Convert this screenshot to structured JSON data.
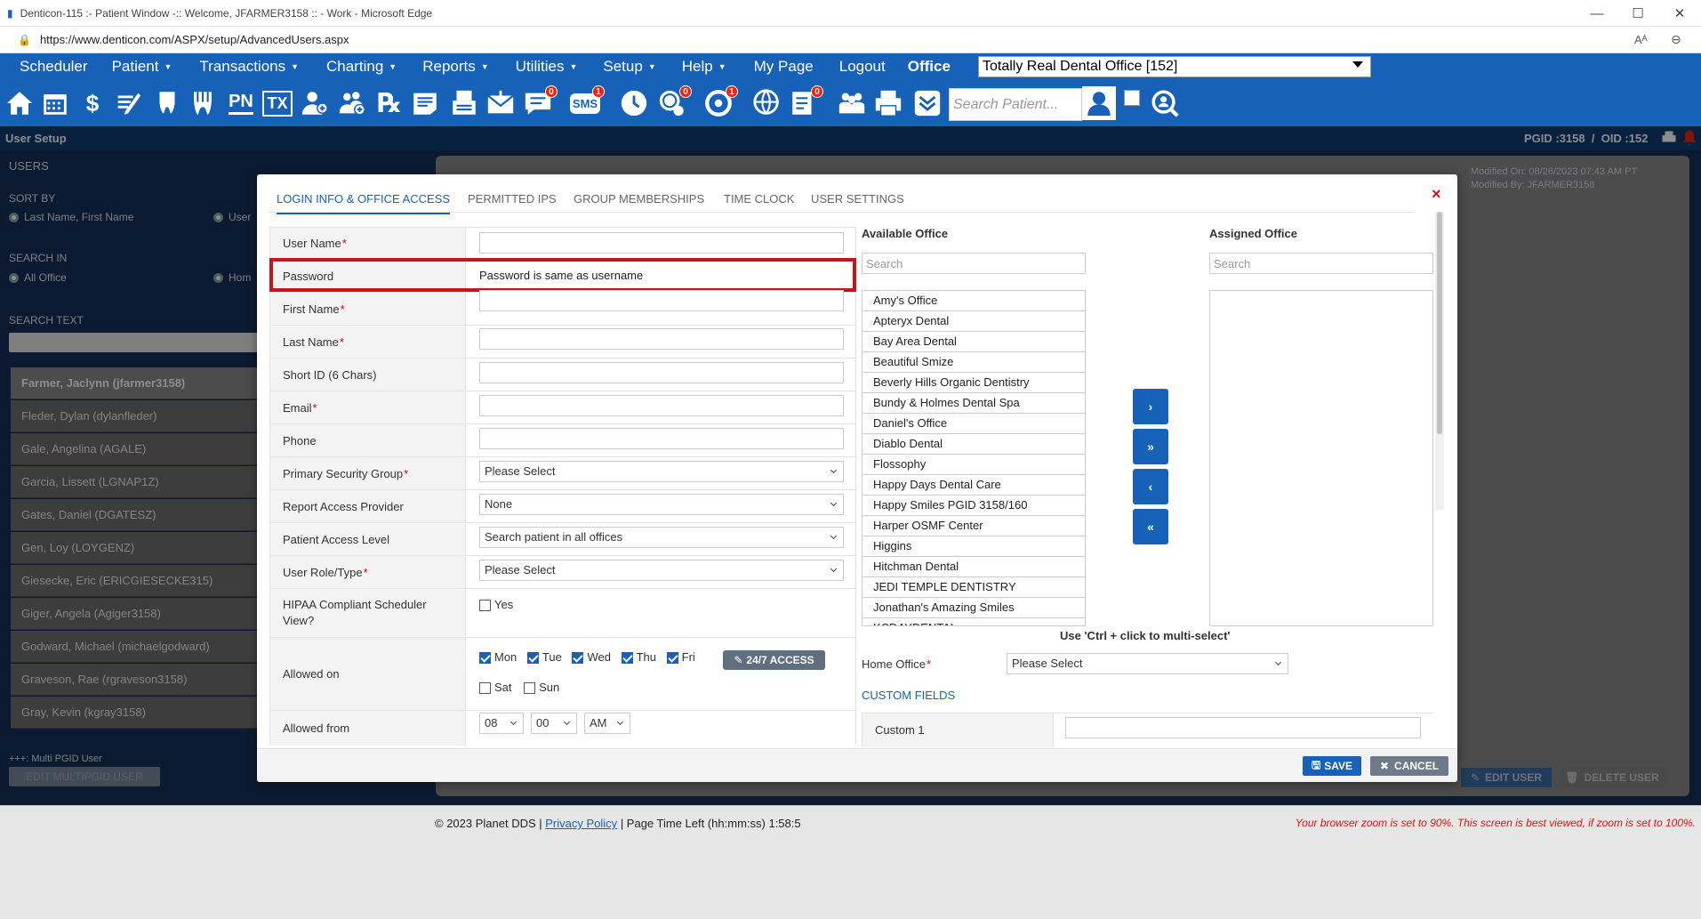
{
  "browser": {
    "title": "Denticon-115 :- Patient Window -:: Welcome, JFARMER3158 :: - Work - Microsoft Edge",
    "url": "https://www.denticon.com/ASPX/setup/AdvancedUsers.aspx"
  },
  "menu": {
    "items": [
      {
        "label": "Scheduler",
        "caret": ""
      },
      {
        "label": "Patient",
        "caret": "▼"
      },
      {
        "label": "Transactions",
        "caret": "▼"
      },
      {
        "label": "Charting",
        "caret": "▼"
      },
      {
        "label": "Reports",
        "caret": "▼"
      },
      {
        "label": "Utilities",
        "caret": "▼"
      },
      {
        "label": "Setup",
        "caret": "▼"
      },
      {
        "label": "Help",
        "caret": "▼"
      },
      {
        "label": "My Page",
        "caret": ""
      },
      {
        "label": "Logout",
        "caret": ""
      }
    ],
    "office_label": "Office",
    "office_value": "Totally Real Dental Office [152]"
  },
  "toolbar": {
    "search_placeholder": "Search Patient...",
    "badges": {
      "messages": "0",
      "sms": "1",
      "alerts": "0",
      "recall": "1",
      "tasks": "0"
    },
    "pn_label": "PN",
    "tx_label": "TX",
    "sms_label": "SMS"
  },
  "page": {
    "title": "User Setup",
    "pgid_info": "PGID :3158  /  OID :152"
  },
  "left": {
    "users_header": "USERS",
    "sort_by": "SORT BY",
    "sort_option1": "Last Name, First Name",
    "sort_option2": "User",
    "search_in": "SEARCH IN",
    "search_option1": "All Office",
    "search_option2": "Hom",
    "search_text": "SEARCH TEXT",
    "users": [
      "Farmer, Jaclynn (jfarmer3158)",
      "Fleder, Dylan (dylanfleder)",
      "Gale, Angelina (AGALE)",
      "Garcia, Lissett (LGNAP1Z)",
      "Gates, Daniel (DGATESZ)",
      "Gen, Loy (LOYGENZ)",
      "Giesecke, Eric (ERICGIESECKE315)",
      "Giger, Angela (Agiger3158)",
      "Godward, Michael (michaelgodward)",
      "Graveson, Rae (rgraveson3158)",
      "Gray, Kevin (kgray3158)"
    ],
    "multi_pgid": "+++: Multi PGID User",
    "edit_multi": "EDIT MULTIPGID USER"
  },
  "background": {
    "modified_on": "Modified On: 08/26/2023 07:43 AM PT",
    "modified_by": "Modified By: JFARMER3158",
    "edit_user": "EDIT USER",
    "delete_user": "DELETE USER"
  },
  "modal": {
    "tabs": [
      "LOGIN INFO & OFFICE ACCESS",
      "PERMITTED IPS",
      "GROUP MEMBERSHIPS",
      "TIME CLOCK",
      "USER SETTINGS"
    ],
    "close": "×",
    "fields": {
      "username": "User Name",
      "password": "Password",
      "password_value": "Password is same as username",
      "firstname": "First Name",
      "lastname": "Last Name",
      "shortid": "Short ID (6 Chars)",
      "email": "Email",
      "phone": "Phone",
      "primary_group": "Primary Security Group",
      "primary_group_value": "Please Select",
      "report_access": "Report Access Provider",
      "report_access_value": "None",
      "patient_access": "Patient Access Level",
      "patient_access_value": "Search patient in all offices",
      "user_role": "User Role/Type",
      "user_role_value": "Please Select",
      "hipaa": "HIPAA Compliant Scheduler View?",
      "hipaa_yes": "Yes",
      "allowed_on": "Allowed on",
      "days": [
        "Mon",
        "Tue",
        "Wed",
        "Thu",
        "Fri",
        "Sat",
        "Sun"
      ],
      "access_247": "24/7 ACCESS",
      "allowed_from": "Allowed from",
      "from_hour": "08",
      "from_min": "00",
      "from_ampm": "AM"
    },
    "available_office": "Available Office",
    "assigned_office": "Assigned Office",
    "search_placeholder": "Search",
    "offices": [
      "Amy's Office",
      "Apteryx Dental",
      "Bay Area Dental",
      "Beautiful Smize",
      "Beverly Hills Organic Dentistry",
      "Bundy & Holmes Dental Spa",
      "Daniel's Office",
      "Diablo Dental",
      "Flossophy",
      "Happy Days Dental Care",
      "Happy Smiles PGID 3158/160",
      "Harper OSMF Center",
      "Higgins",
      "Hitchman Dental",
      "JEDI TEMPLE DENTISTRY",
      "Jonathan's Amazing Smiles",
      "KCDAYDENTAL"
    ],
    "transfer": [
      "›",
      "»",
      "‹",
      "«"
    ],
    "multi_select": "Use 'Ctrl + click to multi-select'",
    "home_office": "Home Office",
    "home_office_value": "Please Select",
    "custom_fields": "CUSTOM FIELDS",
    "custom1": "Custom 1",
    "save": "SAVE",
    "cancel": "CANCEL"
  },
  "footer": {
    "copyright": "© 2023 Planet DDS |",
    "privacy": "Privacy Policy",
    "time_left": "| Page Time Left (hh:mm:ss) 1:58:5",
    "zoom_warning": "Your browser zoom is set to 90%. This screen is best viewed, if zoom is set to 100%."
  },
  "colors": {
    "brand_blue": "#1762b8",
    "header_navy": "#0d3d73",
    "highlight_red": "#c8141c"
  }
}
